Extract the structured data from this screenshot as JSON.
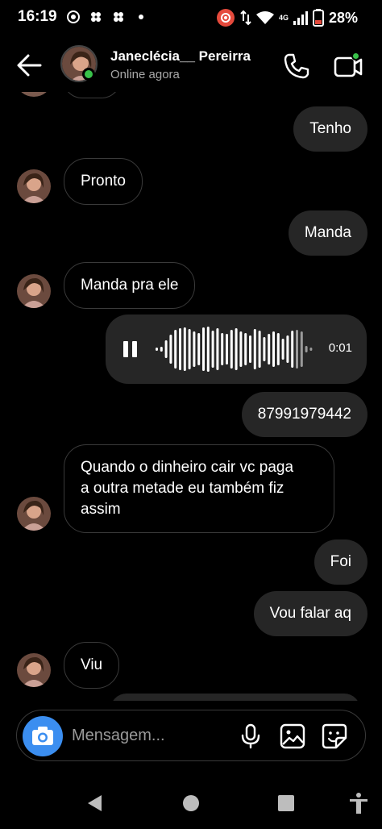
{
  "status_bar": {
    "time": "16:19",
    "network": "4G",
    "battery": "28%"
  },
  "header": {
    "contact_name": "Janeclécia__ Pereirra",
    "contact_status": "Online agora"
  },
  "messages": [
    {
      "id": "m1",
      "direction": "out",
      "text": "Tenho"
    },
    {
      "id": "m2",
      "direction": "in",
      "text": "Pronto"
    },
    {
      "id": "m3",
      "direction": "out",
      "text": "Manda"
    },
    {
      "id": "m4",
      "direction": "in",
      "text": "Manda pra ele"
    },
    {
      "id": "m5",
      "direction": "out",
      "type": "voice",
      "duration": "0:01"
    },
    {
      "id": "m6",
      "direction": "out",
      "text": "87991979442"
    },
    {
      "id": "m7",
      "direction": "in",
      "lines": [
        "Quando o dinheiro cair vc paga",
        "a outra metade eu também fiz",
        "assim"
      ]
    },
    {
      "id": "m8",
      "direction": "out",
      "text": "Foi"
    },
    {
      "id": "m9",
      "direction": "out",
      "text": "Vou falar aq"
    },
    {
      "id": "m10",
      "direction": "in",
      "text": "Viu"
    }
  ],
  "composer": {
    "placeholder": "Mensagem..."
  },
  "colors": {
    "accent": "#3b8ef0",
    "online": "#39c24a",
    "outgoing_bubble": "#262626",
    "background": "#000000"
  },
  "icons": [
    "back-arrow-icon",
    "phone-icon",
    "video-call-icon",
    "camera-icon",
    "microphone-icon",
    "gallery-icon",
    "sticker-icon",
    "pause-icon"
  ]
}
